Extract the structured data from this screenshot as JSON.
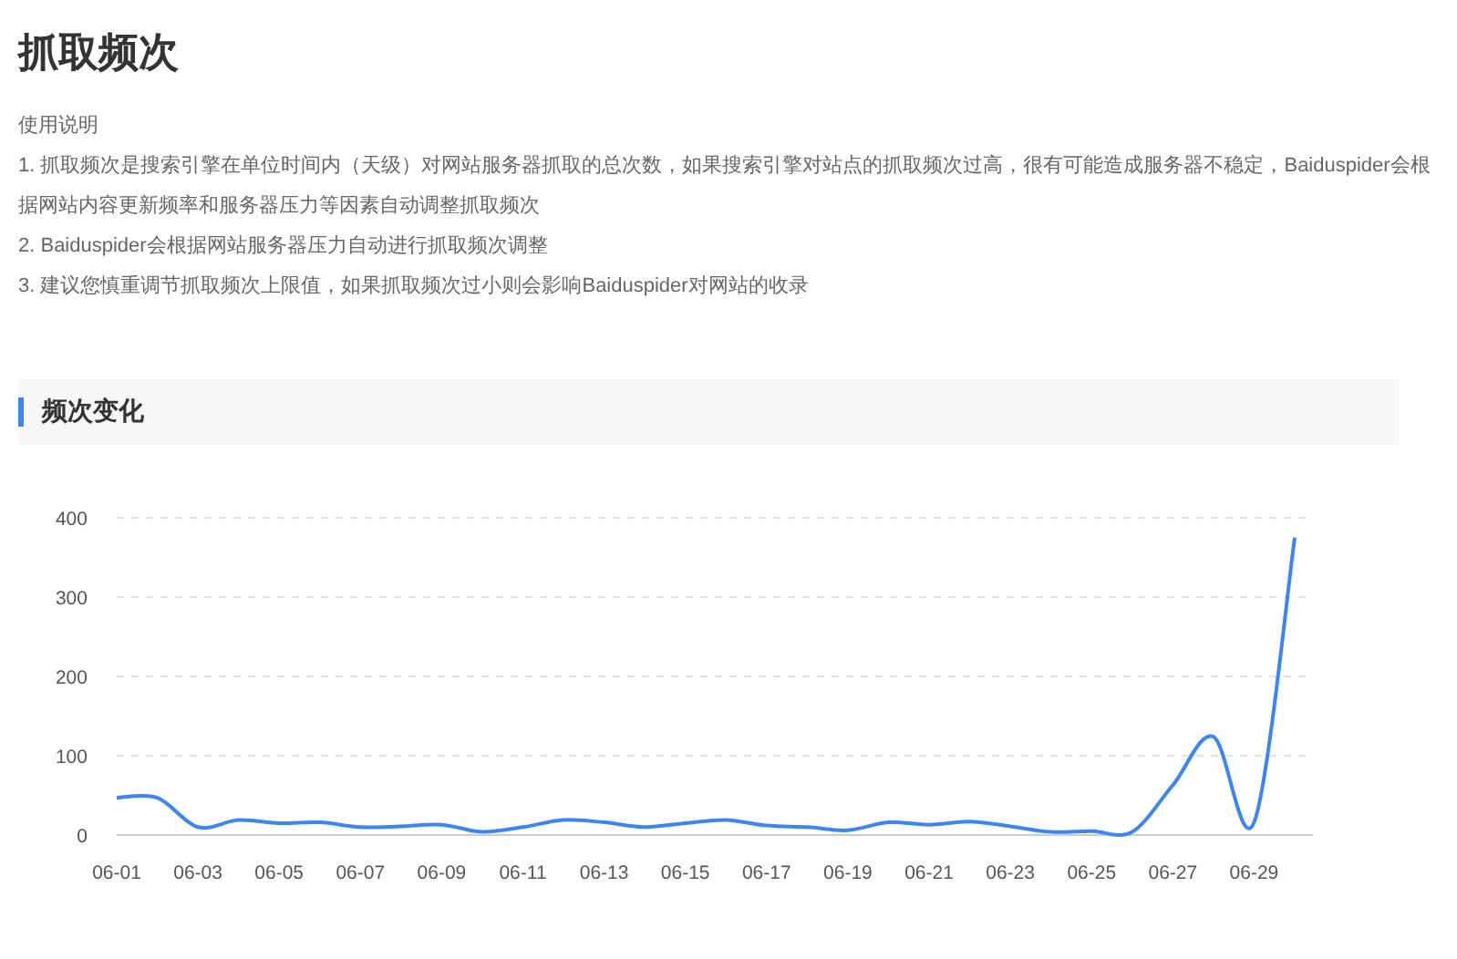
{
  "page_title": "抓取频次",
  "instructions": {
    "heading": "使用说明",
    "items": [
      "1. 抓取频次是搜索引擎在单位时间内（天级）对网站服务器抓取的总次数，如果搜索引擎对站点的抓取频次过高，很有可能造成服务器不稳定，Baiduspider会根据网站内容更新频率和服务器压力等因素自动调整抓取频次",
      "2. Baiduspider会根据网站服务器压力自动进行抓取频次调整",
      "3. 建议您慎重调节抓取频次上限值，如果抓取频次过小则会影响Baiduspider对网站的收录"
    ]
  },
  "section": {
    "title": "频次变化",
    "chart_data": {
      "type": "line",
      "categories": [
        "06-01",
        null,
        "06-03",
        null,
        "06-05",
        null,
        "06-07",
        null,
        "06-09",
        null,
        "06-11",
        null,
        "06-13",
        null,
        "06-15",
        null,
        "06-17",
        null,
        "06-19",
        null,
        "06-21",
        null,
        "06-23",
        null,
        "06-25",
        null,
        "06-27",
        null,
        "06-29",
        null
      ],
      "grid": true,
      "series": [
        {
          "color": "#3d85f0",
          "values": [
            47,
            47,
            10,
            19,
            15,
            16,
            10,
            11,
            13,
            4,
            10,
            19,
            16,
            10,
            15,
            19,
            12,
            10,
            6,
            16,
            13,
            17,
            11,
            4,
            5,
            4,
            63,
            124,
            16,
            375
          ]
        }
      ],
      "ylim": [
        0,
        400
      ],
      "yticks": [
        0,
        100,
        200,
        300,
        400
      ]
    }
  }
}
